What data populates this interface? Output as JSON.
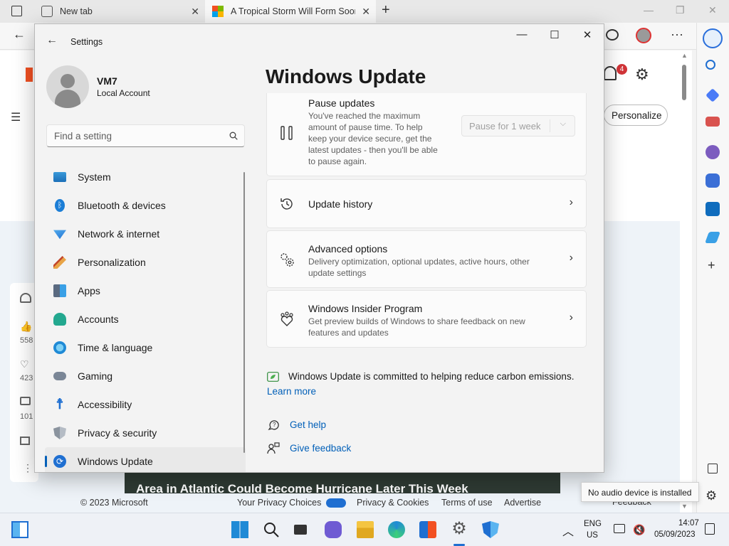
{
  "browser": {
    "tabs": [
      {
        "label": "New tab"
      },
      {
        "label": "A Tropical Storm Will Form Soon"
      }
    ],
    "notification_count": "4",
    "personalize_label": "Personalize",
    "news_headline": "Area in Atlantic Could Become Hurricane Later This Week",
    "side_counts": [
      "558",
      "423",
      "101"
    ],
    "footer": {
      "copyright": "© 2023 Microsoft",
      "privacy_choices": "Your Privacy Choices",
      "privacy_cookies": "Privacy & Cookies",
      "terms": "Terms of use",
      "advertise": "Advertise",
      "feedback": "Feedback"
    }
  },
  "settings": {
    "window_title": "Settings",
    "user": {
      "name": "VM7",
      "type": "Local Account"
    },
    "search_placeholder": "Find a setting",
    "nav": [
      {
        "label": "System",
        "icon": "system-icon"
      },
      {
        "label": "Bluetooth & devices",
        "icon": "bluetooth-icon"
      },
      {
        "label": "Network & internet",
        "icon": "network-icon"
      },
      {
        "label": "Personalization",
        "icon": "brush-icon"
      },
      {
        "label": "Apps",
        "icon": "apps-icon"
      },
      {
        "label": "Accounts",
        "icon": "accounts-icon"
      },
      {
        "label": "Time & language",
        "icon": "clock-globe-icon"
      },
      {
        "label": "Gaming",
        "icon": "gamepad-icon"
      },
      {
        "label": "Accessibility",
        "icon": "accessibility-icon"
      },
      {
        "label": "Privacy & security",
        "icon": "shield-icon"
      },
      {
        "label": "Windows Update",
        "icon": "update-icon",
        "selected": true
      }
    ],
    "page_title": "Windows Update",
    "pause": {
      "title": "Pause updates",
      "desc_lines": [
        "You've reached the maximum",
        "amount of pause time. To help",
        "keep your device secure, get the",
        "latest updates - then you'll be able",
        "to pause again."
      ],
      "select_value": "Pause for 1 week"
    },
    "history": {
      "title": "Update history"
    },
    "advanced": {
      "title": "Advanced options",
      "desc_lines": [
        "Delivery optimization, optional updates, active hours, other",
        "update settings"
      ]
    },
    "insider": {
      "title": "Windows Insider Program",
      "desc_lines": [
        "Get preview builds of Windows to share feedback on new",
        "features and updates"
      ]
    },
    "carbon_text": "Windows Update is committed to helping reduce carbon emissions.",
    "learn_more": "Learn more",
    "get_help": "Get help",
    "give_feedback": "Give feedback"
  },
  "tooltip": "No audio device is installed",
  "taskbar": {
    "lang_top": "ENG",
    "lang_bottom": "US",
    "time": "14:07",
    "date": "05/09/2023"
  },
  "colors": {
    "accent": "#005fb8",
    "selected_bg": "#e9e9e9"
  }
}
